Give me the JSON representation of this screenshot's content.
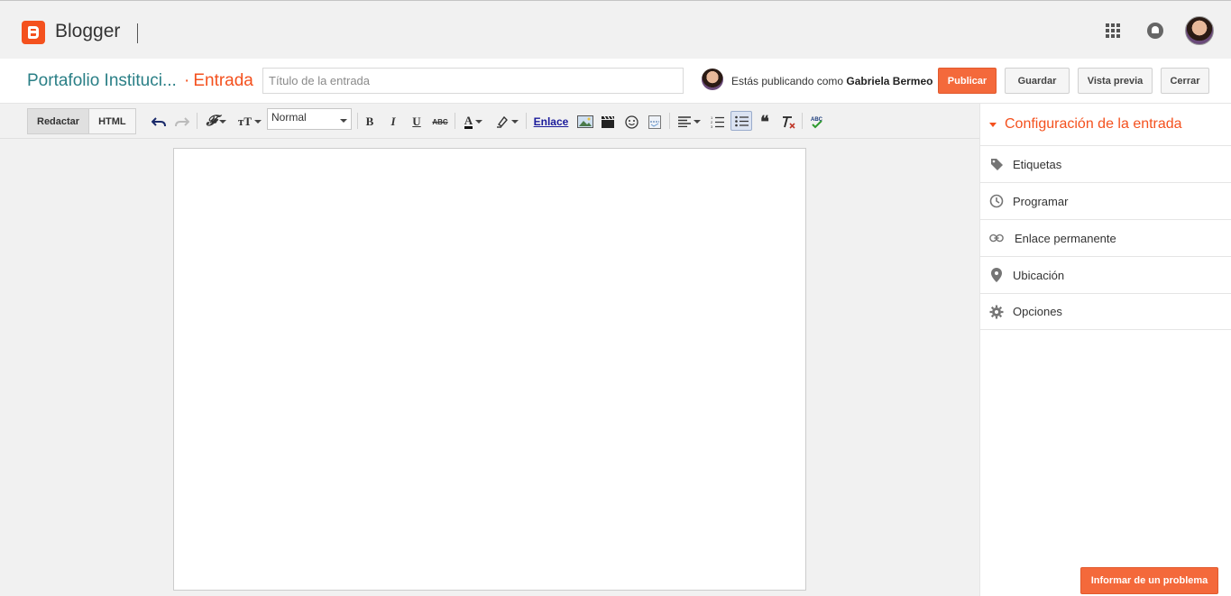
{
  "app": {
    "name": "Blogger"
  },
  "header": {
    "blog_title": "Portafolio Instituci...",
    "post_kind": "Entrada",
    "post_kind_sep": "·",
    "title_placeholder": "Título de la entrada",
    "publishing_as_prefix": "Estás publicando como",
    "publishing_as_user": "Gabriela Bermeo",
    "buttons": {
      "publish": "Publicar",
      "save": "Guardar",
      "preview": "Vista previa",
      "close": "Cerrar"
    }
  },
  "toolbar": {
    "modes": [
      "Redactar",
      "HTML"
    ],
    "format_value": "Normal",
    "link_label": "Enlace"
  },
  "sidebar": {
    "heading": "Configuración de la entrada",
    "items": [
      {
        "label": "Etiquetas",
        "icon": "tag-icon"
      },
      {
        "label": "Programar",
        "icon": "clock-icon"
      },
      {
        "label": "Enlace permanente",
        "icon": "link-icon"
      },
      {
        "label": "Ubicación",
        "icon": "location-pin-icon"
      },
      {
        "label": "Opciones",
        "icon": "gear-icon"
      }
    ]
  },
  "report_button": "Informar de un problema",
  "colors": {
    "accent": "#f4511e",
    "publish_button": "#f4693b",
    "blog_title": "#2a7f86"
  }
}
